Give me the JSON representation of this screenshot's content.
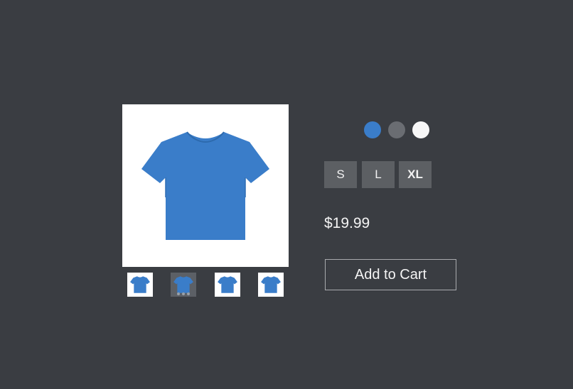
{
  "product": {
    "image_icon": "tshirt-icon",
    "shirt_color": "#3a7dc9",
    "price": "$19.99",
    "add_to_cart_label": "Add to Cart"
  },
  "thumbnails": [
    {
      "icon": "tshirt-icon",
      "selected": false
    },
    {
      "icon": "tshirt-icon",
      "selected": true
    },
    {
      "icon": "tshirt-icon",
      "selected": false
    },
    {
      "icon": "tshirt-icon",
      "selected": false
    }
  ],
  "colors": [
    {
      "name": "blue",
      "hex": "#3a7dc9"
    },
    {
      "name": "gray",
      "hex": "#6a6d72"
    },
    {
      "name": "white",
      "hex": "#f7f7f7"
    }
  ],
  "sizes": [
    {
      "label": "S"
    },
    {
      "label": "L"
    },
    {
      "label": "XL"
    }
  ]
}
